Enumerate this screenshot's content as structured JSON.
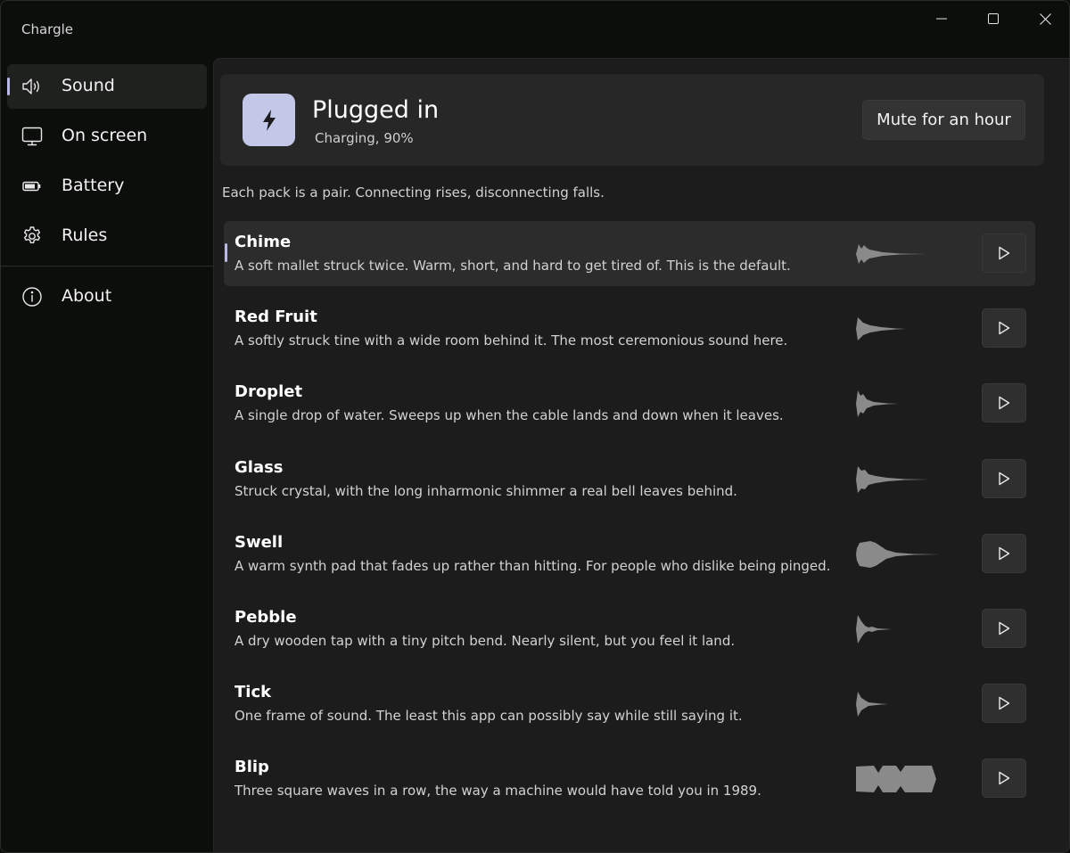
{
  "app": {
    "title": "Chargle"
  },
  "window_controls": {
    "minimize": "minimize-icon",
    "maximize": "maximize-icon",
    "close": "close-icon"
  },
  "sidebar": {
    "items": [
      {
        "label": "Sound",
        "icon": "speaker-icon",
        "selected": true
      },
      {
        "label": "On screen",
        "icon": "monitor-icon",
        "selected": false
      },
      {
        "label": "Battery",
        "icon": "battery-icon",
        "selected": false
      },
      {
        "label": "Rules",
        "icon": "gear-icon",
        "selected": false
      }
    ],
    "footer_items": [
      {
        "label": "About",
        "icon": "info-icon"
      }
    ]
  },
  "status": {
    "icon": "lightning-icon",
    "title": "Plugged in",
    "subtitle": "Charging, 90%",
    "mute_label": "Mute for an hour"
  },
  "hint": "Each pack is a pair. Connecting rises, disconnecting falls.",
  "sounds": [
    {
      "name": "Chime",
      "description": "A soft mallet struck twice. Warm, short, and hard to get tired of. This is the default.",
      "selected": true,
      "waveform": "chime"
    },
    {
      "name": "Red Fruit",
      "description": "A softly struck tine with a wide room behind it. The most ceremonious sound here.",
      "selected": false,
      "waveform": "redfruit"
    },
    {
      "name": "Droplet",
      "description": "A single drop of water. Sweeps up when the cable lands and down when it leaves.",
      "selected": false,
      "waveform": "droplet"
    },
    {
      "name": "Glass",
      "description": "Struck crystal, with the long inharmonic shimmer a real bell leaves behind.",
      "selected": false,
      "waveform": "glass"
    },
    {
      "name": "Swell",
      "description": "A warm synth pad that fades up rather than hitting. For people who dislike being pinged.",
      "selected": false,
      "waveform": "swell"
    },
    {
      "name": "Pebble",
      "description": "A dry wooden tap with a tiny pitch bend. Nearly silent, but you feel it land.",
      "selected": false,
      "waveform": "pebble"
    },
    {
      "name": "Tick",
      "description": "One frame of sound. The least this app can possibly say while still saying it.",
      "selected": false,
      "waveform": "tick"
    },
    {
      "name": "Blip",
      "description": "Three square waves in a row, the way a machine would have told you in 1989.",
      "selected": false,
      "waveform": "blip"
    }
  ],
  "colors": {
    "accent": "#b9b9e6",
    "status_icon_bg": "#c4c8e8",
    "waveform": "#8a8a8a"
  }
}
